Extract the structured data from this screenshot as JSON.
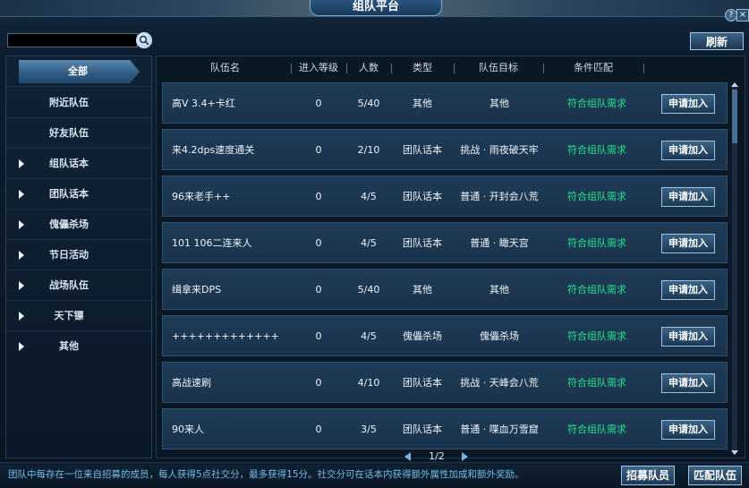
{
  "window": {
    "title": "组队平台"
  },
  "search": {
    "value": "",
    "placeholder": ""
  },
  "toolbar": {
    "refresh_label": "刷新"
  },
  "sidebar": {
    "items": [
      {
        "label": "全部",
        "active": true,
        "expandable": false
      },
      {
        "label": "附近队伍",
        "active": false,
        "expandable": false
      },
      {
        "label": "好友队伍",
        "active": false,
        "expandable": false
      },
      {
        "label": "组队话本",
        "active": false,
        "expandable": true
      },
      {
        "label": "团队话本",
        "active": false,
        "expandable": true
      },
      {
        "label": "傀儡杀场",
        "active": false,
        "expandable": true
      },
      {
        "label": "节日活动",
        "active": false,
        "expandable": true
      },
      {
        "label": "战场队伍",
        "active": false,
        "expandable": true
      },
      {
        "label": "天下镖",
        "active": false,
        "expandable": true
      },
      {
        "label": "其他",
        "active": false,
        "expandable": true
      }
    ]
  },
  "table": {
    "headers": [
      "队伍名",
      "进入等级",
      "人数",
      "类型",
      "队伍目标",
      "条件匹配"
    ],
    "apply_label": "申请加入",
    "rows": [
      {
        "name": "高V 3.4+卡红",
        "level": "0",
        "members": "5/40",
        "type": "其他",
        "target": "其他",
        "match": "符合组队需求"
      },
      {
        "name": "来4.2dps速度通关",
        "level": "0",
        "members": "2/10",
        "type": "团队话本",
        "target": "挑战 · 雨夜破天牢",
        "match": "符合组队需求"
      },
      {
        "name": "96来老手++",
        "level": "0",
        "members": "4/5",
        "type": "团队话本",
        "target": "普通 · 开封会八荒",
        "match": "符合组队需求"
      },
      {
        "name": "101 106二连来人",
        "level": "0",
        "members": "4/5",
        "type": "团队话本",
        "target": "普通 · 瞰天宫",
        "match": "符合组队需求"
      },
      {
        "name": "缉拿来DPS",
        "level": "0",
        "members": "5/40",
        "type": "其他",
        "target": "其他",
        "match": "符合组队需求"
      },
      {
        "name": "+++++++++++++",
        "level": "0",
        "members": "4/5",
        "type": "傀儡杀场",
        "target": "傀儡杀场",
        "match": "符合组队需求"
      },
      {
        "name": "高战速刷",
        "level": "0",
        "members": "4/10",
        "type": "团队话本",
        "target": "挑战 · 天峰会八荒",
        "match": "符合组队需求"
      },
      {
        "name": "90来人",
        "level": "0",
        "members": "3/5",
        "type": "团队话本",
        "target": "普通 · 喋血万雪窟",
        "match": "符合组队需求"
      }
    ]
  },
  "pager": {
    "label": "1/2"
  },
  "footer": {
    "note": "团队中每存在一位来自招募的成员，每人获得5点社交分，最多获得15分。社交分可在话本内获得额外属性加成和额外奖励。",
    "recruit_label": "招募队员",
    "match_label": "匹配队伍"
  },
  "colors": {
    "match_text": "#27e08a",
    "footer_note": "#74bce8",
    "accent": "#3b6387"
  }
}
